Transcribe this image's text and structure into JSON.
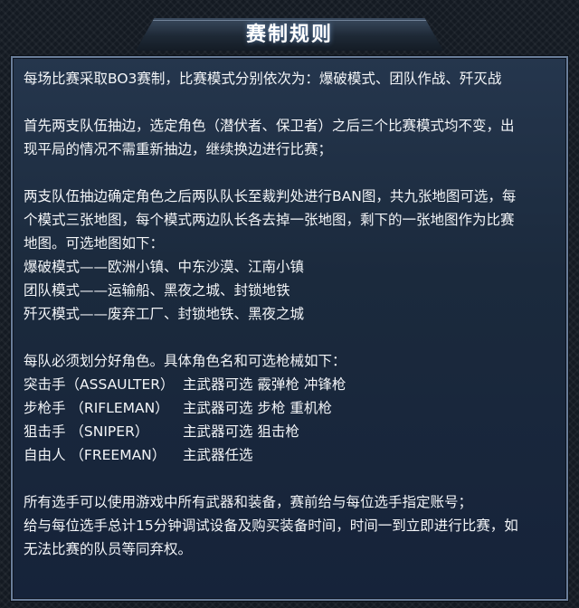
{
  "title": "赛制规则",
  "intro": " 每场比赛采取BO3赛制，比赛模式分别依次为：爆破模式、团队作战、歼灭战",
  "pick_rule": {
    "line1": "首先两支队伍抽边，选定角色（潜伏者、保卫者）之后三个比赛模式均不变，出",
    "line2": "现平局的情况不需重新抽边，继续换边进行比赛；"
  },
  "ban_rule": {
    "line1": "两支队伍抽边确定角色之后两队队长至裁判处进行BAN图，共九张地图可选，每",
    "line2": "个模式三张地图，每个模式两边队长各去掉一张地图，剩下的一张地图作为比赛",
    "line3": "地图。可选地图如下："
  },
  "maps": [
    "爆破模式——欧洲小镇、中东沙漠、江南小镇",
    "团队模式——运输船、黑夜之城、封锁地铁",
    "歼灭模式——废弃工厂、封锁地铁、黑夜之城"
  ],
  "roles_intro": "每队必须划分好角色。具体角色名和可选枪械如下：",
  "roles": [
    {
      "name": "突击手（ASSAULTER）",
      "weapons": "主武器可选 霰弹枪 冲锋枪"
    },
    {
      "name": "步枪手 （RIFLEMAN）",
      "weapons": "主武器可选 步枪 重机枪"
    },
    {
      "name": "狙击手 （SNIPER）",
      "weapons": "主武器可选 狙击枪"
    },
    {
      "name": "自由人 （FREEMAN）",
      "weapons": "主武器任选"
    }
  ],
  "equipment": {
    "line1": "所有选手可以使用游戏中所有武器和装备，赛前给与每位选手指定账号；",
    "line2": "给与每位选手总计15分钟调试设备及购买装备时间，时间一到立即进行比赛，如",
    "line3": "无法比赛的队员等同弃权。"
  }
}
